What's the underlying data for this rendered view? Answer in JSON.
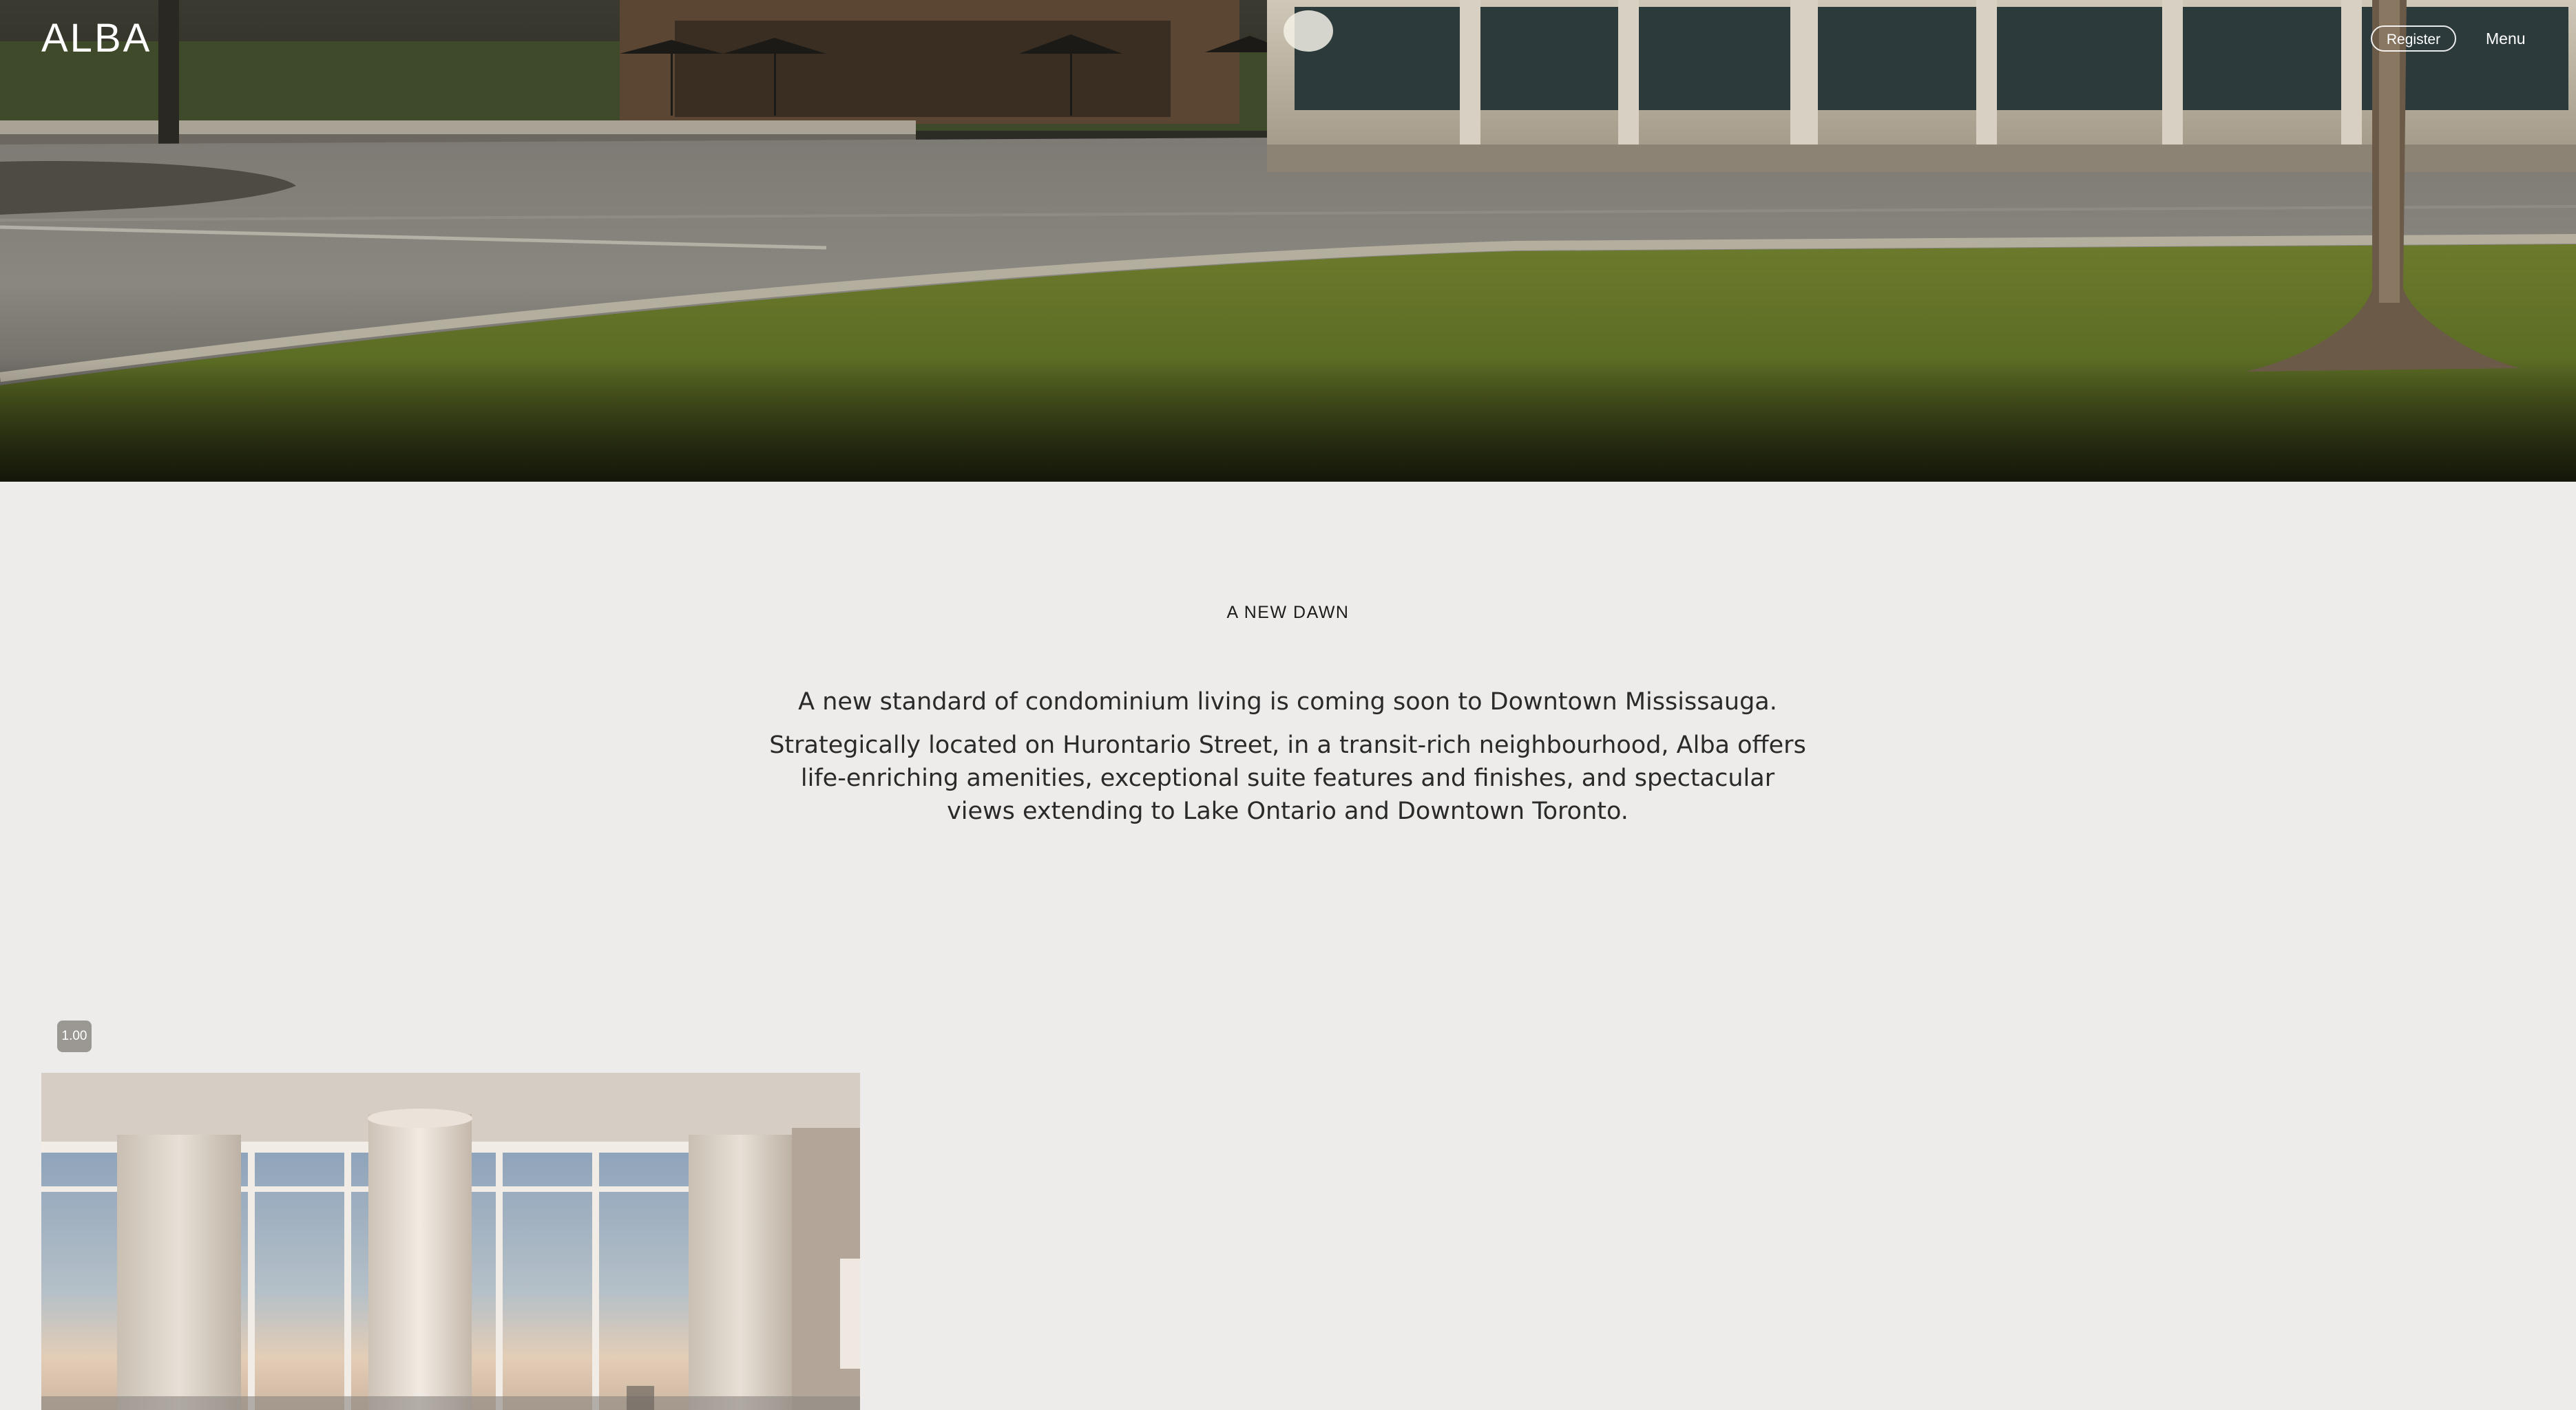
{
  "header": {
    "logo": "ALBA",
    "register_label": "Register",
    "menu_label": "Menu"
  },
  "hero": {
    "image": "streetscape-with-lrt-train-icon"
  },
  "intro": {
    "eyebrow": "A NEW DAWN",
    "lead": "A new standard of condominium living is coming soon to Downtown Mississauga.",
    "body": "Strategically located on Hurontario Street, in a transit-rich neighbourhood, Alba offers life-enriching amenities, exceptional suite features and finishes, and spectacular views extending to Lake Ontario and Downtown Toronto."
  },
  "badge": {
    "value": "1.00"
  },
  "interior": {
    "image": "condo-interior-window-view-icon"
  },
  "colors": {
    "background": "#edecea",
    "text": "#2a2a2a",
    "badge": "#9b9893"
  }
}
